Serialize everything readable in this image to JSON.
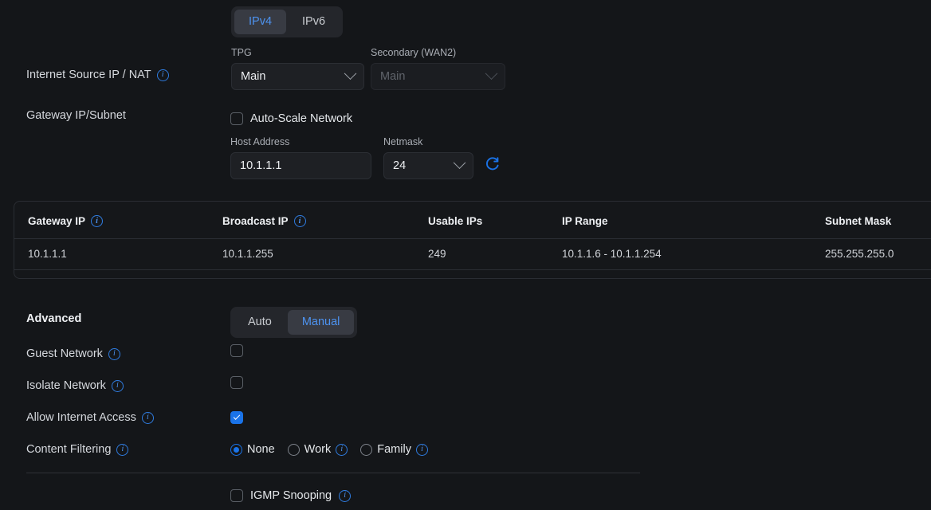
{
  "ip_version_tabs": [
    {
      "label": "IPv4",
      "active": true
    },
    {
      "label": "IPv6",
      "active": false
    }
  ],
  "internet_source": {
    "row_label": "Internet Source IP / NAT",
    "primary": {
      "label": "TPG",
      "value": "Main"
    },
    "secondary": {
      "label": "Secondary (WAN2)",
      "value": "Main",
      "disabled": true
    }
  },
  "gateway_subnet": {
    "row_label": "Gateway IP/Subnet",
    "auto_scale": {
      "label": "Auto-Scale Network",
      "checked": false
    },
    "host_address": {
      "label": "Host Address",
      "value": "10.1.1.1"
    },
    "netmask": {
      "label": "Netmask",
      "value": "24"
    },
    "refresh_icon": "refresh-icon"
  },
  "ip_table": {
    "columns": [
      {
        "label": "Gateway IP",
        "info": true
      },
      {
        "label": "Broadcast IP",
        "info": true
      },
      {
        "label": "Usable IPs",
        "info": false
      },
      {
        "label": "IP Range",
        "info": false
      },
      {
        "label": "Subnet Mask",
        "info": false
      }
    ],
    "rows": [
      [
        "10.1.1.1",
        "10.1.1.255",
        "249",
        "10.1.1.6 - 10.1.1.254",
        "255.255.255.0"
      ]
    ]
  },
  "advanced": {
    "label": "Advanced",
    "mode_tabs": [
      {
        "label": "Auto",
        "active": false
      },
      {
        "label": "Manual",
        "active": true
      }
    ],
    "rows": [
      {
        "label": "Guest Network",
        "info": true,
        "checked": false
      },
      {
        "label": "Isolate Network",
        "info": true,
        "checked": false
      },
      {
        "label": "Allow Internet Access",
        "info": true,
        "checked": true
      }
    ],
    "content_filtering": {
      "label": "Content Filtering",
      "info": true,
      "options": [
        {
          "label": "None",
          "selected": true,
          "info": false
        },
        {
          "label": "Work",
          "selected": false,
          "info": true
        },
        {
          "label": "Family",
          "selected": false,
          "info": true
        }
      ]
    },
    "igmp_snooping": {
      "label": "IGMP Snooping",
      "info": true,
      "checked": false
    }
  },
  "colors": {
    "background": "#141619",
    "accent_blue": "#4d93f0",
    "checkbox_blue": "#1a73e8",
    "card_border": "#2a2d33"
  }
}
